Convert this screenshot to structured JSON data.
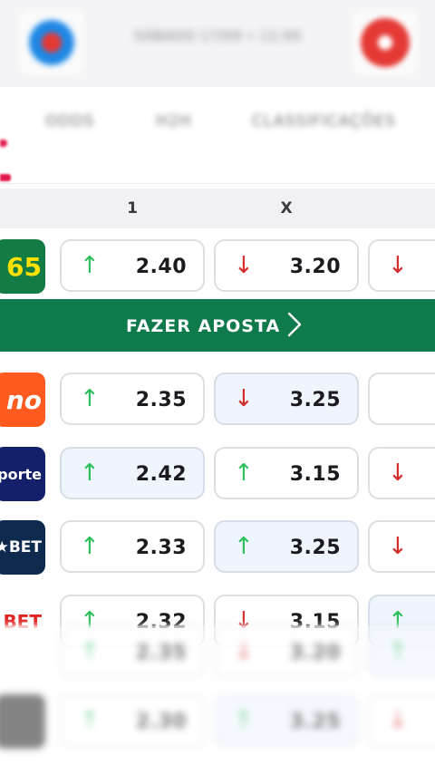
{
  "header": {
    "home_logo_icon": "team-crest-blue",
    "away_logo_icon": "team-crest-red",
    "match_info": "SÁBADO 17/09 • 11:00"
  },
  "tabs": [
    {
      "label": "ODDS",
      "active": true
    },
    {
      "label": "H2H",
      "active": false
    },
    {
      "label": "CLASSIFICAÇÕES",
      "active": false
    }
  ],
  "columns": {
    "c1": "1",
    "c2": "X"
  },
  "cta": {
    "label": "FAZER APOSTA",
    "icon": "chevron-right-icon",
    "color": "#0f7a4b"
  },
  "colors": {
    "up": "#2bbf5a",
    "down": "#d62b2b",
    "accent": "#e2174b",
    "highlight": "#eef5fd"
  },
  "rows": [
    {
      "book": "65",
      "logo_bg": "#137c45",
      "logo_fg": "#ffe100",
      "odds": [
        {
          "value": "2.40",
          "dir": "up"
        },
        {
          "value": "3.20",
          "dir": "down"
        },
        {
          "value": "",
          "dir": "down"
        }
      ]
    },
    {
      "book": "no",
      "logo_bg": "#ff5a1f",
      "logo_fg": "#ffffff",
      "odds": [
        {
          "value": "2.35",
          "dir": "up"
        },
        {
          "value": "3.25",
          "dir": "down"
        },
        {
          "value": "",
          "dir": ""
        }
      ]
    },
    {
      "book": "porte",
      "logo_bg": "#15206b",
      "logo_fg": "#ffffff",
      "odds": [
        {
          "value": "2.42",
          "dir": "up"
        },
        {
          "value": "3.15",
          "dir": "up"
        },
        {
          "value": "",
          "dir": "down"
        }
      ]
    },
    {
      "book": "★BET",
      "logo_bg": "#0e2a4f",
      "logo_fg": "#ffffff",
      "odds": [
        {
          "value": "2.33",
          "dir": "up"
        },
        {
          "value": "3.25",
          "dir": "up"
        },
        {
          "value": "",
          "dir": "down"
        }
      ]
    },
    {
      "book": "BET",
      "logo_bg": "#ffffff",
      "logo_fg": "#e02424",
      "odds": [
        {
          "value": "2.32",
          "dir": "up"
        },
        {
          "value": "3.15",
          "dir": "down"
        },
        {
          "value": "",
          "dir": "up"
        }
      ]
    },
    {
      "book": "",
      "logo_bg": "#ffffff",
      "logo_fg": "#e02424",
      "odds": [
        {
          "value": "2.35",
          "dir": "up"
        },
        {
          "value": "3.20",
          "dir": "down"
        },
        {
          "value": "",
          "dir": "up"
        }
      ]
    },
    {
      "book": "",
      "logo_bg": "#222222",
      "logo_fg": "#ffffff",
      "odds": [
        {
          "value": "2.30",
          "dir": "up"
        },
        {
          "value": "3.25",
          "dir": "up"
        },
        {
          "value": "",
          "dir": "down"
        }
      ]
    }
  ]
}
